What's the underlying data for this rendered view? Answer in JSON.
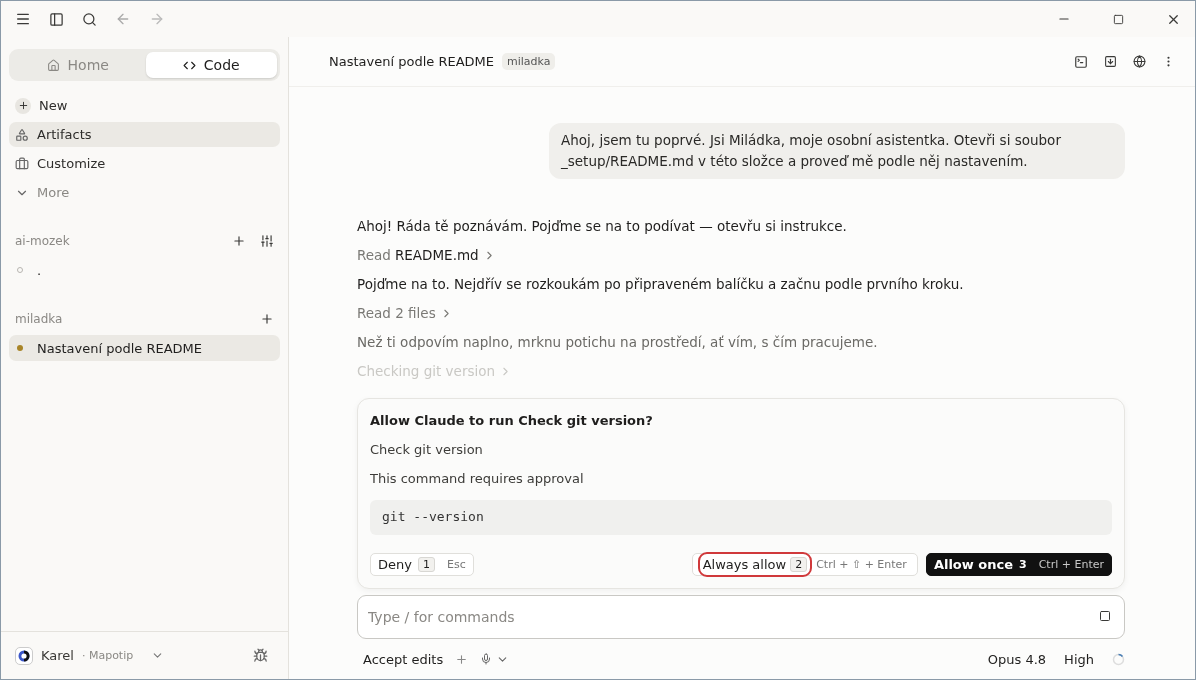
{
  "modes": [
    {
      "label": "Home",
      "selected": false
    },
    {
      "label": "Code",
      "selected": true
    }
  ],
  "nav": [
    {
      "label": "New",
      "kind": "action",
      "selected": false
    },
    {
      "label": "Artifacts",
      "kind": "link",
      "selected": true
    },
    {
      "label": "Customize",
      "kind": "link",
      "selected": false
    },
    {
      "label": "More",
      "kind": "expander",
      "selected": false
    }
  ],
  "projects": [
    {
      "name": "ai-mozek",
      "filter": true,
      "sessions": [
        {
          "label": ".",
          "selected": false
        }
      ]
    },
    {
      "name": "miladka",
      "filter": false,
      "sessions": [
        {
          "label": "Nastavení podle README",
          "selected": true
        }
      ]
    }
  ],
  "user": {
    "name": "Karel",
    "org": "· Mapotip"
  },
  "header": {
    "title": "Nastavení podle README",
    "tag": "miladka"
  },
  "user_message": "Ahoj, jsem tu poprvé. Jsi Miládka, moje osobní asistentka. Otevři si soubor _setup/README.md v této složce a proveď mě podle něj nastavením.",
  "transcript": [
    {
      "kind": "text",
      "text": "Ahoj! Ráda tě poznávám. Pojďme se na to podívat — otevřu si instrukce.",
      "faded": false
    },
    {
      "kind": "tool",
      "verb": "Read",
      "target": "README.md"
    },
    {
      "kind": "text",
      "text": "Pojďme na to. Nejdřív se rozkoukám po připraveném balíčku a začnu podle prvního kroku.",
      "faded": false
    },
    {
      "kind": "tool",
      "verb": "Read 2 files"
    },
    {
      "kind": "text",
      "text": "Než ti odpovím naplno, mrknu potichu na prostředí, ať vím, s čím pracujeme.",
      "faded": true
    },
    {
      "kind": "pending",
      "verb": "Checking git version"
    }
  ],
  "approval": {
    "title": "Allow Claude to run Check git version?",
    "subtitle": "Check git version",
    "note": "This command requires approval",
    "command": "git --version",
    "deny": {
      "label": "Deny",
      "key": "1",
      "shortcut": "Esc"
    },
    "always": {
      "label": "Always allow",
      "key": "2",
      "shortcut": "Ctrl + ⇧ + Enter",
      "highlighted": true
    },
    "once": {
      "label": "Allow once",
      "key": "3",
      "shortcut": "Ctrl + Enter"
    }
  },
  "composer": {
    "placeholder": "Type / for commands"
  },
  "footer": {
    "mode": "Accept edits",
    "model": "Opus 4.8",
    "effort": "High"
  }
}
